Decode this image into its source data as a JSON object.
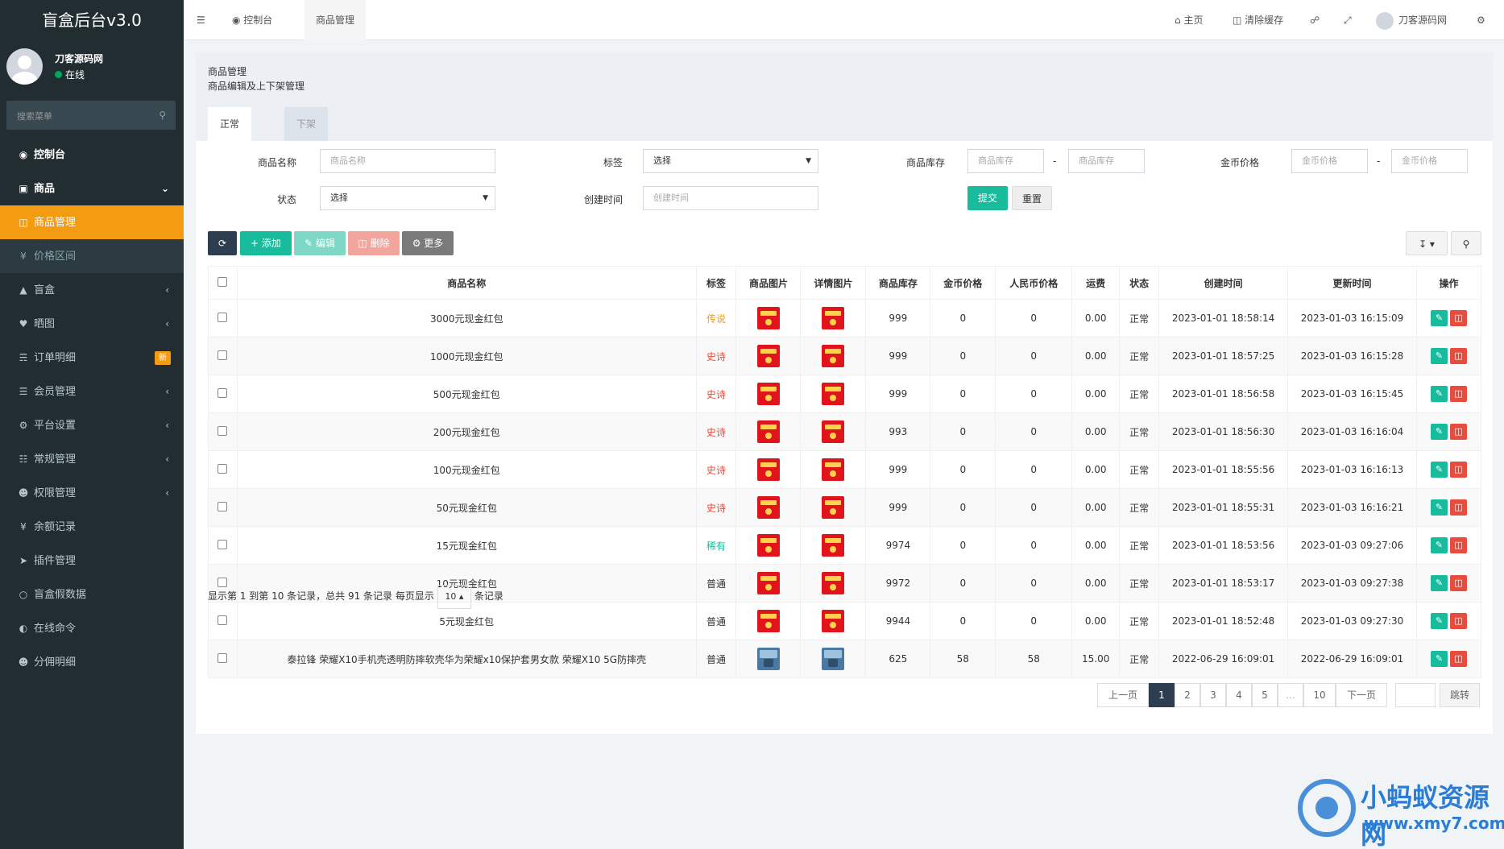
{
  "app": {
    "title": "盲盒后台v3.0"
  },
  "user": {
    "name": "刀客源码网",
    "status": "在线"
  },
  "sidebar": {
    "search_placeholder": "搜索菜单",
    "items": [
      {
        "label": "控制台",
        "icon": "dashboard-icon"
      },
      {
        "label": "商品",
        "icon": "shopping-bag-icon"
      },
      {
        "label": "商品管理",
        "icon": "gift-icon"
      },
      {
        "label": "价格区间",
        "icon": "yen-icon"
      },
      {
        "label": "盲盒",
        "icon": "cube-icon"
      },
      {
        "label": "晒图",
        "icon": "heart-icon"
      },
      {
        "label": "订单明细",
        "icon": "cart-icon",
        "badge": "新"
      },
      {
        "label": "会员管理",
        "icon": "list-icon"
      },
      {
        "label": "平台设置",
        "icon": "gear-icon"
      },
      {
        "label": "常规管理",
        "icon": "database-icon"
      },
      {
        "label": "权限管理",
        "icon": "users-icon"
      },
      {
        "label": "余额记录",
        "icon": "yen-icon"
      },
      {
        "label": "插件管理",
        "icon": "rocket-icon"
      },
      {
        "label": "盲盒假数据",
        "icon": "circle-icon"
      },
      {
        "label": "在线命令",
        "icon": "half-circle-icon"
      },
      {
        "label": "分佣明细",
        "icon": "users-icon"
      }
    ]
  },
  "topbar": {
    "tabs": [
      "控制台",
      "商品管理"
    ],
    "home": "主页",
    "clear_cache": "清除缓存",
    "username": "刀客源码网"
  },
  "page": {
    "title": "商品管理",
    "subtitle": "商品编辑及上下架管理",
    "tabs": [
      "正常",
      "下架"
    ]
  },
  "filters": {
    "name_label": "商品名称",
    "name_placeholder": "商品名称",
    "tag_label": "标签",
    "tag_value": "选择",
    "stock_label": "商品库存",
    "stock_min_placeholder": "商品库存",
    "stock_max_placeholder": "商品库存",
    "gold_label": "金币价格",
    "gold_min_placeholder": "金币价格",
    "gold_max_placeholder": "金币价格",
    "status_label": "状态",
    "status_value": "选择",
    "created_label": "创建时间",
    "created_placeholder": "创建时间",
    "submit": "提交",
    "reset": "重置",
    "dash": "-"
  },
  "toolbar": {
    "add": "添加",
    "edit": "编辑",
    "delete": "删除",
    "more": "更多"
  },
  "table": {
    "headers": [
      "商品名称",
      "标签",
      "商品图片",
      "详情图片",
      "商品库存",
      "金币价格",
      "人民币价格",
      "运费",
      "状态",
      "创建时间",
      "更新时间",
      "操作"
    ],
    "rows": [
      {
        "name": "3000元现金红包",
        "tag": "传说",
        "tag_color": "#f39c12",
        "img": "red",
        "stock": "999",
        "gold": "0",
        "rmb": "0",
        "ship": "0.00",
        "status": "正常",
        "created": "2023-01-01 18:58:14",
        "updated": "2023-01-03 16:15:09"
      },
      {
        "name": "1000元现金红包",
        "tag": "史诗",
        "tag_color": "#e74c3c",
        "img": "red",
        "stock": "999",
        "gold": "0",
        "rmb": "0",
        "ship": "0.00",
        "status": "正常",
        "created": "2023-01-01 18:57:25",
        "updated": "2023-01-03 16:15:28"
      },
      {
        "name": "500元现金红包",
        "tag": "史诗",
        "tag_color": "#e74c3c",
        "img": "red",
        "stock": "999",
        "gold": "0",
        "rmb": "0",
        "ship": "0.00",
        "status": "正常",
        "created": "2023-01-01 18:56:58",
        "updated": "2023-01-03 16:15:45"
      },
      {
        "name": "200元现金红包",
        "tag": "史诗",
        "tag_color": "#e74c3c",
        "img": "red",
        "stock": "993",
        "gold": "0",
        "rmb": "0",
        "ship": "0.00",
        "status": "正常",
        "created": "2023-01-01 18:56:30",
        "updated": "2023-01-03 16:16:04"
      },
      {
        "name": "100元现金红包",
        "tag": "史诗",
        "tag_color": "#e74c3c",
        "img": "red",
        "stock": "999",
        "gold": "0",
        "rmb": "0",
        "ship": "0.00",
        "status": "正常",
        "created": "2023-01-01 18:55:56",
        "updated": "2023-01-03 16:16:13"
      },
      {
        "name": "50元现金红包",
        "tag": "史诗",
        "tag_color": "#e74c3c",
        "img": "red",
        "stock": "999",
        "gold": "0",
        "rmb": "0",
        "ship": "0.00",
        "status": "正常",
        "created": "2023-01-01 18:55:31",
        "updated": "2023-01-03 16:16:21"
      },
      {
        "name": "15元现金红包",
        "tag": "稀有",
        "tag_color": "#18bc9c",
        "img": "red",
        "stock": "9974",
        "gold": "0",
        "rmb": "0",
        "ship": "0.00",
        "status": "正常",
        "created": "2023-01-01 18:53:56",
        "updated": "2023-01-03 09:27:06"
      },
      {
        "name": "10元现金红包",
        "tag": "普通",
        "tag_color": "#333333",
        "img": "red",
        "stock": "9972",
        "gold": "0",
        "rmb": "0",
        "ship": "0.00",
        "status": "正常",
        "created": "2023-01-01 18:53:17",
        "updated": "2023-01-03 09:27:38"
      },
      {
        "name": "5元现金红包",
        "tag": "普通",
        "tag_color": "#333333",
        "img": "red",
        "stock": "9944",
        "gold": "0",
        "rmb": "0",
        "ship": "0.00",
        "status": "正常",
        "created": "2023-01-01 18:52:48",
        "updated": "2023-01-03 09:27:30"
      },
      {
        "name": "泰拉锋 荣耀X10手机壳透明防摔软壳华为荣耀x10保护套男女款 荣耀X10 5G防摔壳",
        "tag": "普通",
        "tag_color": "#333333",
        "img": "photo",
        "stock": "625",
        "gold": "58",
        "rmb": "58",
        "ship": "15.00",
        "status": "正常",
        "created": "2022-06-29 16:09:01",
        "updated": "2022-06-29 16:09:01"
      }
    ]
  },
  "pagination": {
    "info_prefix": "显示第 1 到第 10 条记录，总共 91 条记录 每页显示",
    "page_size": "10",
    "info_suffix": "条记录",
    "prev": "上一页",
    "next": "下一页",
    "pages": [
      "1",
      "2",
      "3",
      "4",
      "5",
      "...",
      "10"
    ],
    "jump": "跳转"
  },
  "watermark": {
    "cn": "小蚂蚁资源网",
    "url": "www.xmy7.com"
  },
  "colors": {
    "sidebar_bg": "#222d32",
    "active": "#f39c12",
    "success": "#18bc9c",
    "danger": "#e74c3c",
    "primary_dark": "#2c3e50"
  }
}
